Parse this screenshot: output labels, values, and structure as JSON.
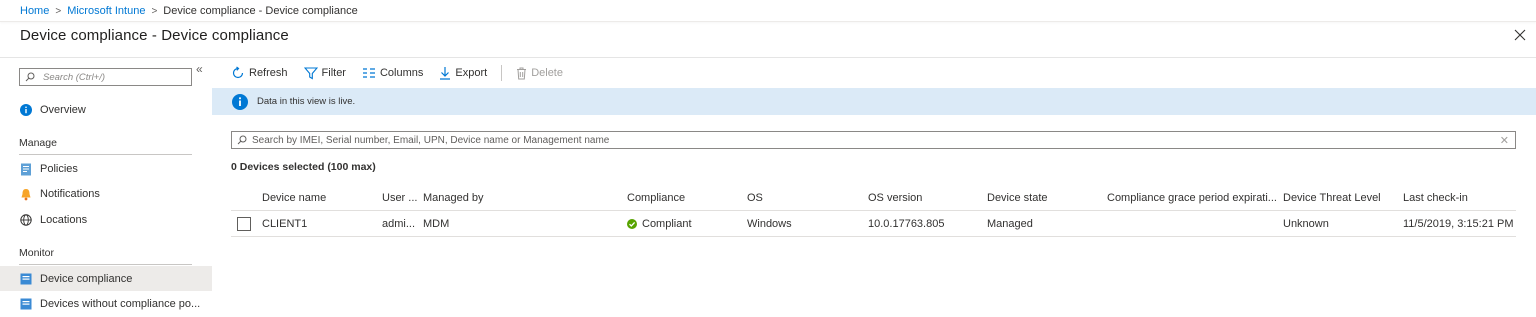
{
  "breadcrumb": [
    {
      "label": "Home"
    },
    {
      "label": "Microsoft Intune"
    },
    {
      "label": "Device compliance - Device compliance"
    }
  ],
  "blade_title": "Device compliance - Device compliance",
  "sidebar": {
    "search_placeholder": "Search (Ctrl+/)",
    "collapse_glyph": "«",
    "overview": "Overview",
    "manage_section": "Manage",
    "manage_items": [
      "Policies",
      "Notifications",
      "Locations"
    ],
    "monitor_section": "Monitor",
    "monitor_items": [
      "Device compliance",
      "Devices without compliance po..."
    ]
  },
  "toolbar": {
    "refresh": "Refresh",
    "filter": "Filter",
    "columns": "Columns",
    "export": "Export",
    "delete": "Delete"
  },
  "info_bar": {
    "message": "Data in this view is live."
  },
  "search": {
    "placeholder": "Search by IMEI, Serial number, Email, UPN, Device name or Management name"
  },
  "selected_count": "0 Devices selected (100 max)",
  "table": {
    "columns": [
      "Device name",
      "User ...",
      "Managed by",
      "Compliance",
      "OS",
      "OS version",
      "Device state",
      "Compliance grace period expirati...",
      "Device Threat Level",
      "Last check-in"
    ],
    "rows": [
      {
        "device_name": "CLIENT1",
        "user": "admi...",
        "managed_by": "MDM",
        "compliance": "Compliant",
        "os": "Windows",
        "os_version": "10.0.17763.805",
        "device_state": "Managed",
        "grace_period": "",
        "threat_level": "Unknown",
        "last_checkin": "11/5/2019, 3:15:21 PM"
      }
    ]
  },
  "colors": {
    "accent": "#0078d4",
    "info_bg": "#dbeaf7",
    "compliant": "#57a300",
    "selected_nav": "#edebe9"
  }
}
